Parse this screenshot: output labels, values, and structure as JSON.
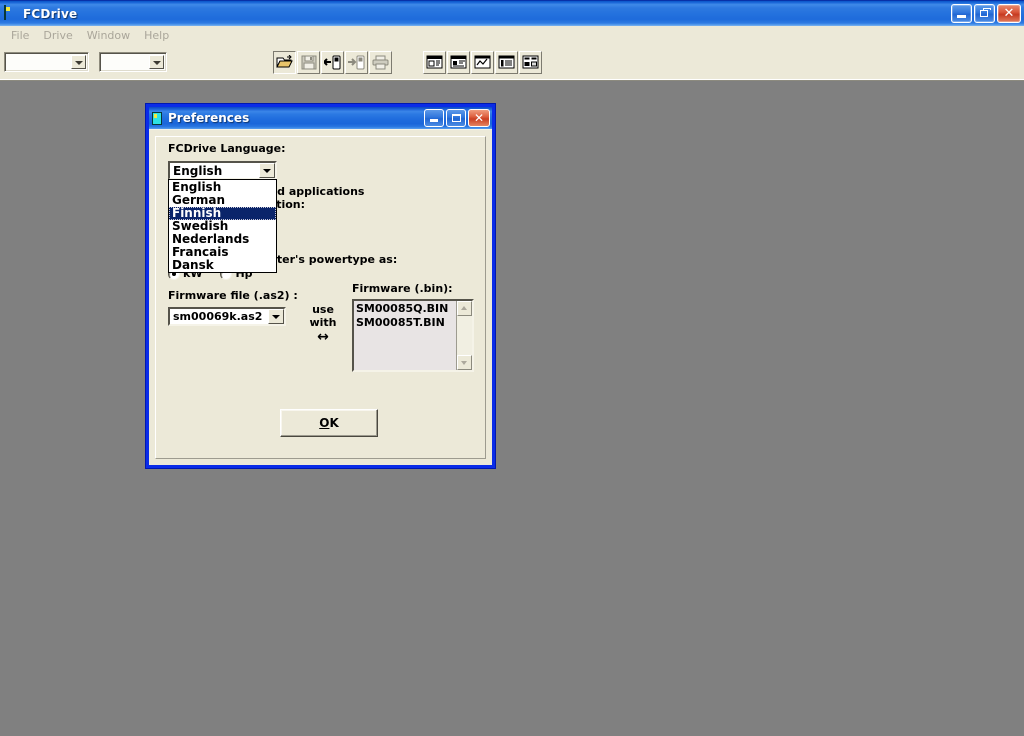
{
  "app": {
    "title": "FCDrive",
    "icon": "drive-icon",
    "window_buttons": [
      {
        "name": "minimize",
        "glyph": "_"
      },
      {
        "name": "restore",
        "glyph": "❐"
      },
      {
        "name": "close",
        "glyph": "×"
      }
    ],
    "menu": [
      {
        "label": "File"
      },
      {
        "label": "Drive"
      },
      {
        "label": "Window"
      },
      {
        "label": "Help"
      }
    ],
    "toolbar": {
      "combo_one_value": "",
      "combo_two_value": "",
      "group_one": [
        {
          "name": "open-folder-icon",
          "label": "Open"
        },
        {
          "name": "save-disk-icon",
          "label": "Save"
        },
        {
          "name": "upload-from-drive-icon",
          "label": "Read from drive"
        },
        {
          "name": "download-to-drive-icon",
          "label": "Write to drive"
        },
        {
          "name": "print-icon",
          "label": "Print"
        }
      ],
      "group_two": [
        {
          "name": "window-parameters-icon",
          "label": "Parameters"
        },
        {
          "name": "window-monitor-icon",
          "label": "Monitor"
        },
        {
          "name": "window-graph-icon",
          "label": "Graph"
        },
        {
          "name": "window-list-icon",
          "label": "List"
        },
        {
          "name": "window-tile-icon",
          "label": "Tile"
        }
      ]
    }
  },
  "dialog": {
    "title": "Preferences",
    "icon": "drive-icon",
    "window_buttons": [
      {
        "name": "minimize",
        "glyph": "_"
      },
      {
        "name": "maximize",
        "glyph": "□"
      },
      {
        "name": "close",
        "glyph": "×"
      }
    ],
    "language": {
      "label": "FCDrive Language:",
      "selected": "English",
      "options": [
        "English",
        "German",
        "Finnish",
        "Swedish",
        "Nederlands",
        "Francais",
        "Dansk"
      ],
      "highlighted_option": "Finnish",
      "dropdown_open": true
    },
    "overlapped_text": {
      "line1": "or old applications",
      "line2": "efinition:",
      "line3": "nverter's powertype as:"
    },
    "powertype": {
      "options": [
        {
          "label": "kW",
          "checked": true
        },
        {
          "label": "Hp",
          "checked": false
        }
      ]
    },
    "firmware": {
      "as2_label": "Firmware file (.as2) :",
      "as2_value": "sm00069k.as2",
      "use_with_label": "use with",
      "use_with_arrow": "↔",
      "bin_label": "Firmware (.bin):",
      "bin_items": [
        "SM00085Q.BIN",
        "SM00085T.BIN"
      ]
    },
    "ok_button": {
      "accel": "O",
      "rest": "K"
    }
  },
  "colors": {
    "desktop": "#808080",
    "face": "#ece9d8",
    "title_blue": "#2472de",
    "dialog_frame": "#0a2ce8",
    "selection": "#0a246a",
    "close_red": "#cb3f22"
  }
}
